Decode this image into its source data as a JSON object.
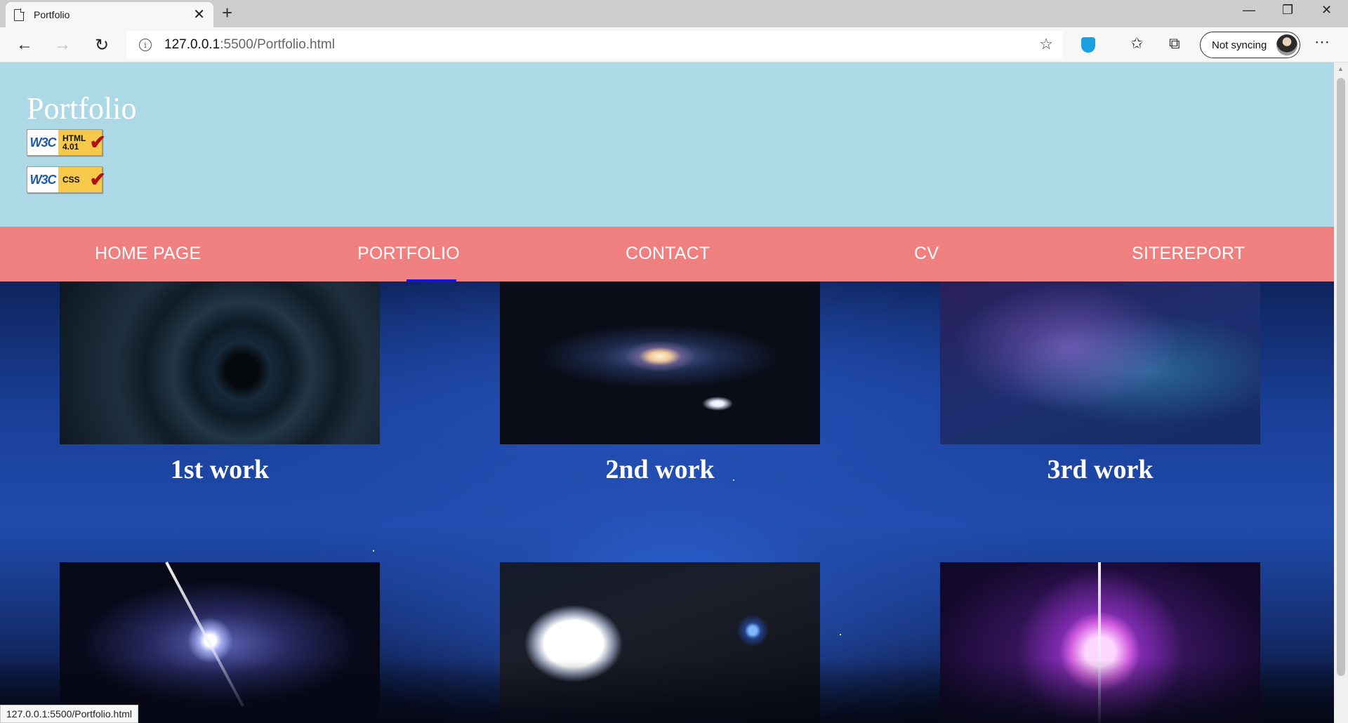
{
  "browser": {
    "tab_title": "Portfolio",
    "url_host": "127.0.0.1",
    "url_rest": ":5500/Portfolio.html",
    "sync_label": "Not syncing",
    "status_url": "127.0.0.1:5500/Portfolio.html"
  },
  "site": {
    "title": "Portfolio",
    "badges": [
      {
        "logo": "W3C",
        "line1": "HTML",
        "line2": "4.01"
      },
      {
        "logo": "W3C",
        "line1": "CSS",
        "line2": ""
      }
    ],
    "nav": [
      {
        "label": "HOME PAGE"
      },
      {
        "label": "PORTFOLIO",
        "active": true
      },
      {
        "label": "CONTACT"
      },
      {
        "label": "CV"
      },
      {
        "label": "SITEREPORT"
      }
    ],
    "works": [
      {
        "caption": "1st work"
      },
      {
        "caption": "2nd work"
      },
      {
        "caption": "3rd work"
      },
      {
        "caption": ""
      },
      {
        "caption": ""
      },
      {
        "caption": ""
      }
    ]
  },
  "colors": {
    "header_bg": "#add8e6",
    "nav_bg": "#f08080",
    "active_underline": "#1a12d8"
  }
}
